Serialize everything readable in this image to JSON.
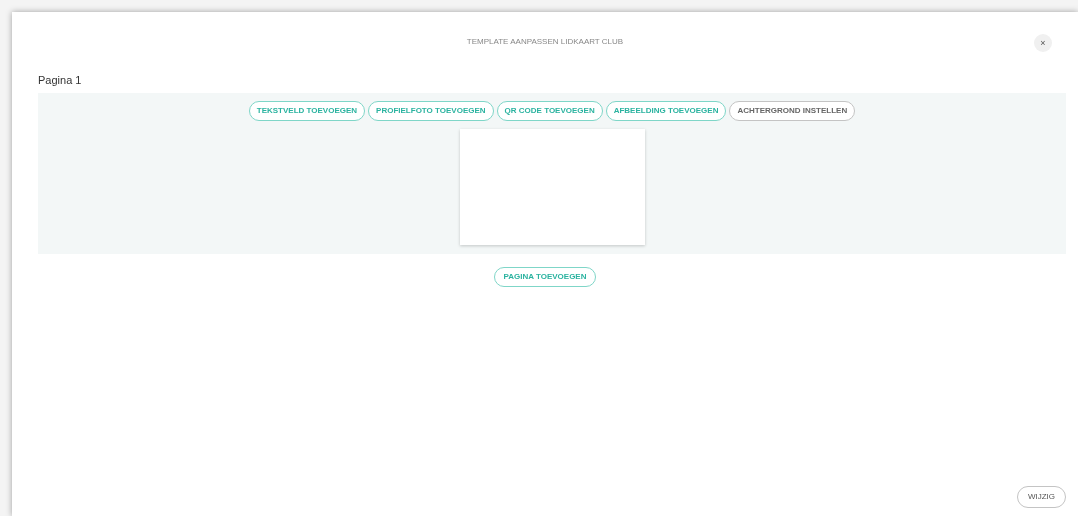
{
  "dialog": {
    "title": "TEMPLATE AANPASSEN LIDKAART CLUB",
    "close": "×"
  },
  "page": {
    "title": "Pagina 1",
    "toolbar": [
      {
        "label": "TEKSTVELD TOEVOEGEN",
        "kind": "accent"
      },
      {
        "label": "PROFIELFOTO TOEVOEGEN",
        "kind": "accent"
      },
      {
        "label": "QR CODE TOEVOEGEN",
        "kind": "accent"
      },
      {
        "label": "AFBEELDING TOEVOEGEN",
        "kind": "accent"
      },
      {
        "label": "ACHTERGROND INSTELLEN",
        "kind": "neutral"
      }
    ]
  },
  "add_page": "PAGINA TOEVOEGEN",
  "save": "WIJZIG"
}
